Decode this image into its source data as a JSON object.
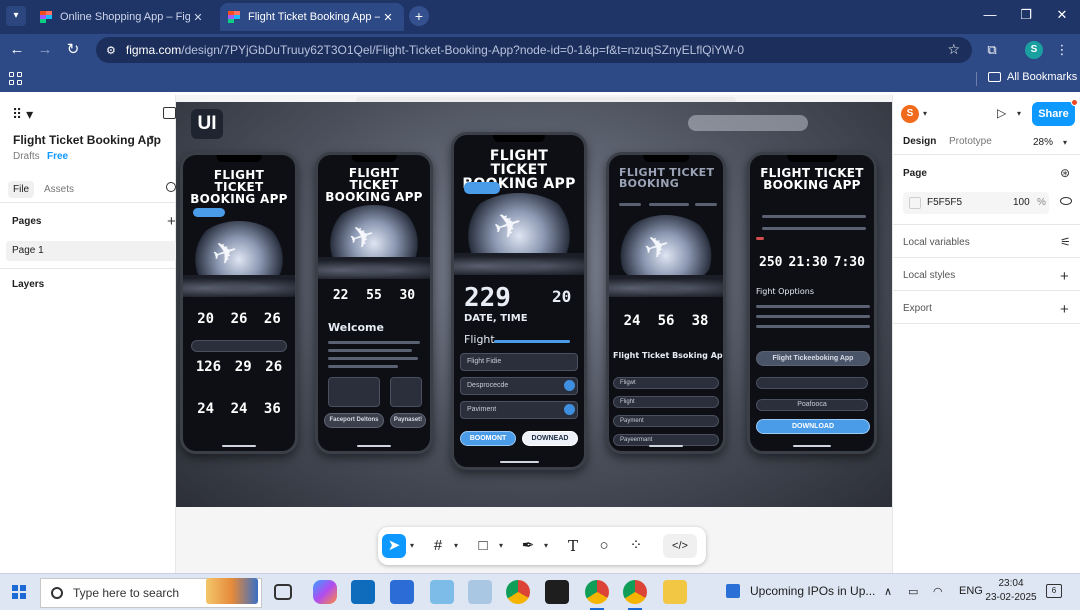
{
  "browser": {
    "tabs": [
      {
        "title": "Online Shopping App – Figma",
        "active": false
      },
      {
        "title": "Flight Ticket Booking App – Fig",
        "active": true
      }
    ],
    "url_host": "figma.com",
    "url_path": "/design/7PYjGbDuTruuy62T3O1Qel/Flight-Ticket-Booking-App?node-id=0-1&p=f&t=nzuqSZnyELflQiYW-0",
    "profile_initial": "S",
    "all_bookmarks": "All Bookmarks",
    "window_controls": {
      "minimize": "—",
      "restore": "❐",
      "close": "✕"
    }
  },
  "left_panel": {
    "file_name": "Flight Ticket Booking App",
    "drafts": "Drafts",
    "plan": "Free",
    "tabs": [
      "File",
      "Assets"
    ],
    "pages_label": "Pages",
    "pages": [
      "Page 1"
    ],
    "layers_label": "Layers"
  },
  "canvas": {
    "ui_badge": "UI",
    "phones": [
      {
        "title": "FLIGHT TICKET BOOKING APP",
        "row1": [
          "20",
          "26",
          "26"
        ],
        "row2": [
          "126",
          "29",
          "26"
        ],
        "row3": [
          "24",
          "24",
          "36"
        ]
      },
      {
        "title": "FLIGHT TICKET BOOKING APP",
        "row1": [
          "22",
          "55",
          "30"
        ],
        "welcome": "Welcome",
        "bottom_buttons": [
          "Faceport Deltons",
          "Paynaset!"
        ]
      },
      {
        "title": "FLIGHT TICKET BOOKING APP",
        "big_numbers": [
          "229",
          "20"
        ],
        "date_time": "DATE, TIME",
        "flight_label": "Flight",
        "rows": [
          "Flight Fidie",
          "Desprocecde",
          "Paviment"
        ],
        "buttons": [
          "BOOMONT",
          "DOWNEAD"
        ]
      },
      {
        "title": "FLIGHT TICKET BOOKING",
        "row1": [
          "24",
          "56",
          "38"
        ],
        "heading": "Flight Ticket Bsoking App",
        "rows": [
          "Fligwt",
          "Flight",
          "Payment",
          "Payeermant"
        ]
      },
      {
        "title": "FLIGHT TICKET BOOKING APP",
        "times": [
          "250",
          "21:30",
          "7:30"
        ],
        "options_label": "Fight Opptions",
        "app_button": "Flight Tickeeboking App",
        "mid_text": "Poafooca",
        "download": "DOWNLOAD"
      }
    ]
  },
  "bottom_toolbar": {
    "tools": [
      "move-tool",
      "frame-tool",
      "shape-tool",
      "pen-tool",
      "text-tool",
      "comment-tool",
      "actions-tool",
      "dev-mode-toggle"
    ]
  },
  "right_panel": {
    "avatar_initial": "S",
    "share": "Share",
    "tabs": [
      "Design",
      "Prototype"
    ],
    "zoom": "28%",
    "page_label": "Page",
    "page_color": "F5F5F5",
    "page_opacity": "100",
    "percent": "%",
    "local_variables": "Local variables",
    "local_styles": "Local styles",
    "export": "Export"
  },
  "taskbar": {
    "search_placeholder": "Type here to search",
    "news": "Upcoming IPOs in Up...",
    "language": "ENG",
    "time": "23:04",
    "date": "23-02-2025",
    "notifications": "6"
  },
  "colors": {
    "figma_blue": "#0d99ff",
    "chrome_frame": "#2d4a86",
    "canvas_bg": "#f5f5f5"
  }
}
